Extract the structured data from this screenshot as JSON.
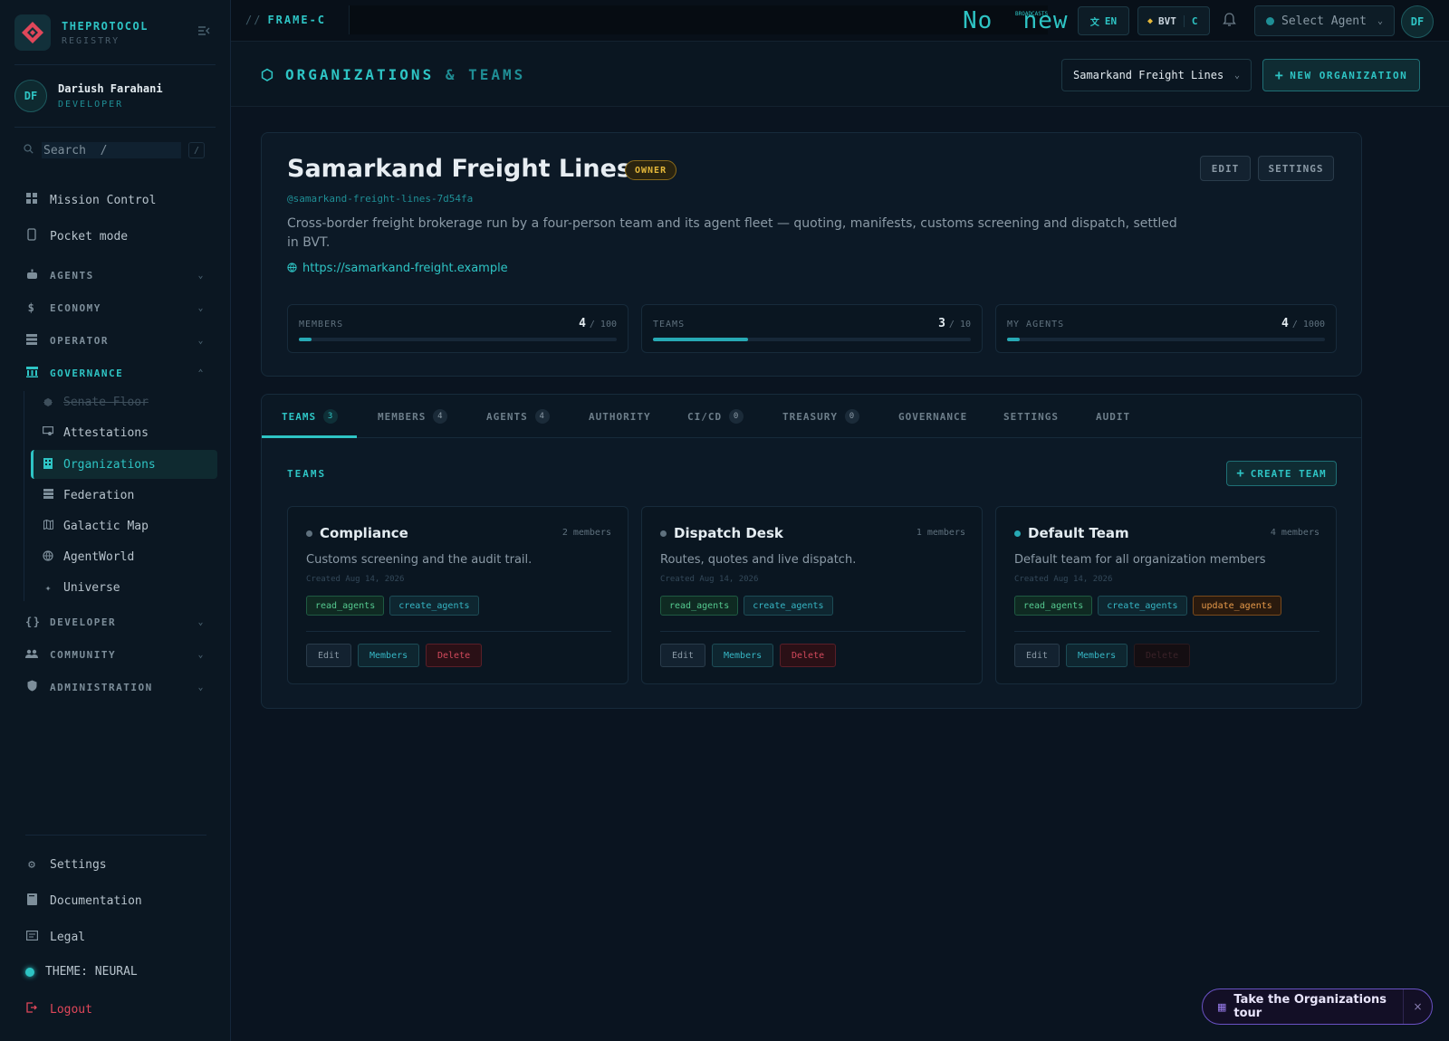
{
  "brand": {
    "name": "THEPROTOCOL",
    "sub": "REGISTRY"
  },
  "user": {
    "initials": "DF",
    "name": "Dariush Farahani",
    "role": "DEVELOPER"
  },
  "search": {
    "placeholder": "Search  /",
    "kbd": "/"
  },
  "nav": {
    "top": [
      {
        "label": "Mission Control",
        "icon": "grid-icon"
      },
      {
        "label": "Pocket mode",
        "icon": "phone-icon"
      }
    ],
    "groups": {
      "agents": "AGENTS",
      "economy": "ECONOMY",
      "operator": "OPERATOR",
      "governance": "GOVERNANCE",
      "developer": "DEVELOPER",
      "community": "COMMUNITY",
      "administration": "ADMINISTRATION"
    },
    "governance_items": [
      "Senate Floor",
      "Attestations",
      "Organizations",
      "Federation",
      "Galactic Map",
      "AgentWorld",
      "Universe"
    ],
    "bottom": {
      "settings": "Settings",
      "documentation": "Documentation",
      "legal": "Legal",
      "theme": "THEME: NEURAL",
      "logout": "Logout"
    }
  },
  "topbar": {
    "frame": "FRAME-C",
    "ticker_main": "No  new",
    "ticker_sub": "BROADCASTS",
    "lang": "EN",
    "currency": "BVT",
    "currency_suffix": "C",
    "agent_placeholder": "Select Agent",
    "avatar": "DF"
  },
  "header": {
    "title_part1": "ORGANIZATIONS",
    "title_amp": "&",
    "title_part2": "TEAMS",
    "org_selected": "Samarkand Freight Lines",
    "new_org": "NEW ORGANIZATION"
  },
  "org": {
    "name": "Samarkand Freight Lines",
    "badge": "OWNER",
    "slug": "@samarkand-freight-lines-7d54fa",
    "description": "Cross-border freight brokerage run by a four-person team and its agent fleet — quoting, manifests, customs screening and dispatch, settled in BVT.",
    "url": "https://samarkand-freight.example",
    "edit": "EDIT",
    "settings": "SETTINGS",
    "stats": [
      {
        "label": "MEMBERS",
        "value": "4",
        "max": "/ 100",
        "progress": 0.04
      },
      {
        "label": "TEAMS",
        "value": "3",
        "max": "/ 10",
        "progress": 0.3
      },
      {
        "label": "MY AGENTS",
        "value": "4",
        "max": "/ 1000",
        "progress": 0.004
      }
    ]
  },
  "tabs": [
    {
      "label": "TEAMS",
      "count": "3"
    },
    {
      "label": "MEMBERS",
      "count": "4"
    },
    {
      "label": "AGENTS",
      "count": "4"
    },
    {
      "label": "AUTHORITY"
    },
    {
      "label": "CI/CD",
      "count": "0"
    },
    {
      "label": "TREASURY",
      "count": "0"
    },
    {
      "label": "GOVERNANCE"
    },
    {
      "label": "SETTINGS"
    },
    {
      "label": "AUDIT"
    }
  ],
  "teams_section": {
    "title": "TEAMS",
    "create": "CREATE TEAM",
    "teams": [
      {
        "name": "Compliance",
        "members": "2 members",
        "description": "Customs screening and the audit trail.",
        "created": "Created Aug 14, 2026",
        "perms": [
          "read_agents",
          "create_agents"
        ],
        "edit": "Edit",
        "members_btn": "Members",
        "delete": "Delete"
      },
      {
        "name": "Dispatch Desk",
        "members": "1 members",
        "description": "Routes, quotes and live dispatch.",
        "created": "Created Aug 14, 2026",
        "perms": [
          "read_agents",
          "create_agents"
        ],
        "edit": "Edit",
        "members_btn": "Members",
        "delete": "Delete"
      },
      {
        "name": "Default Team",
        "members": "4 members",
        "description": "Default team for all organization members",
        "created": "Created Aug 14, 2026",
        "perms": [
          "read_agents",
          "create_agents",
          "update_agents"
        ],
        "edit": "Edit",
        "members_btn": "Members",
        "delete": "Delete"
      }
    ]
  },
  "tour": {
    "label": "Take the Organizations tour",
    "close": "×"
  },
  "colors": {
    "accent": "#2ec4c4",
    "owner": "#e6b93a",
    "danger": "#e0475a",
    "tour": "#6a52c4"
  }
}
